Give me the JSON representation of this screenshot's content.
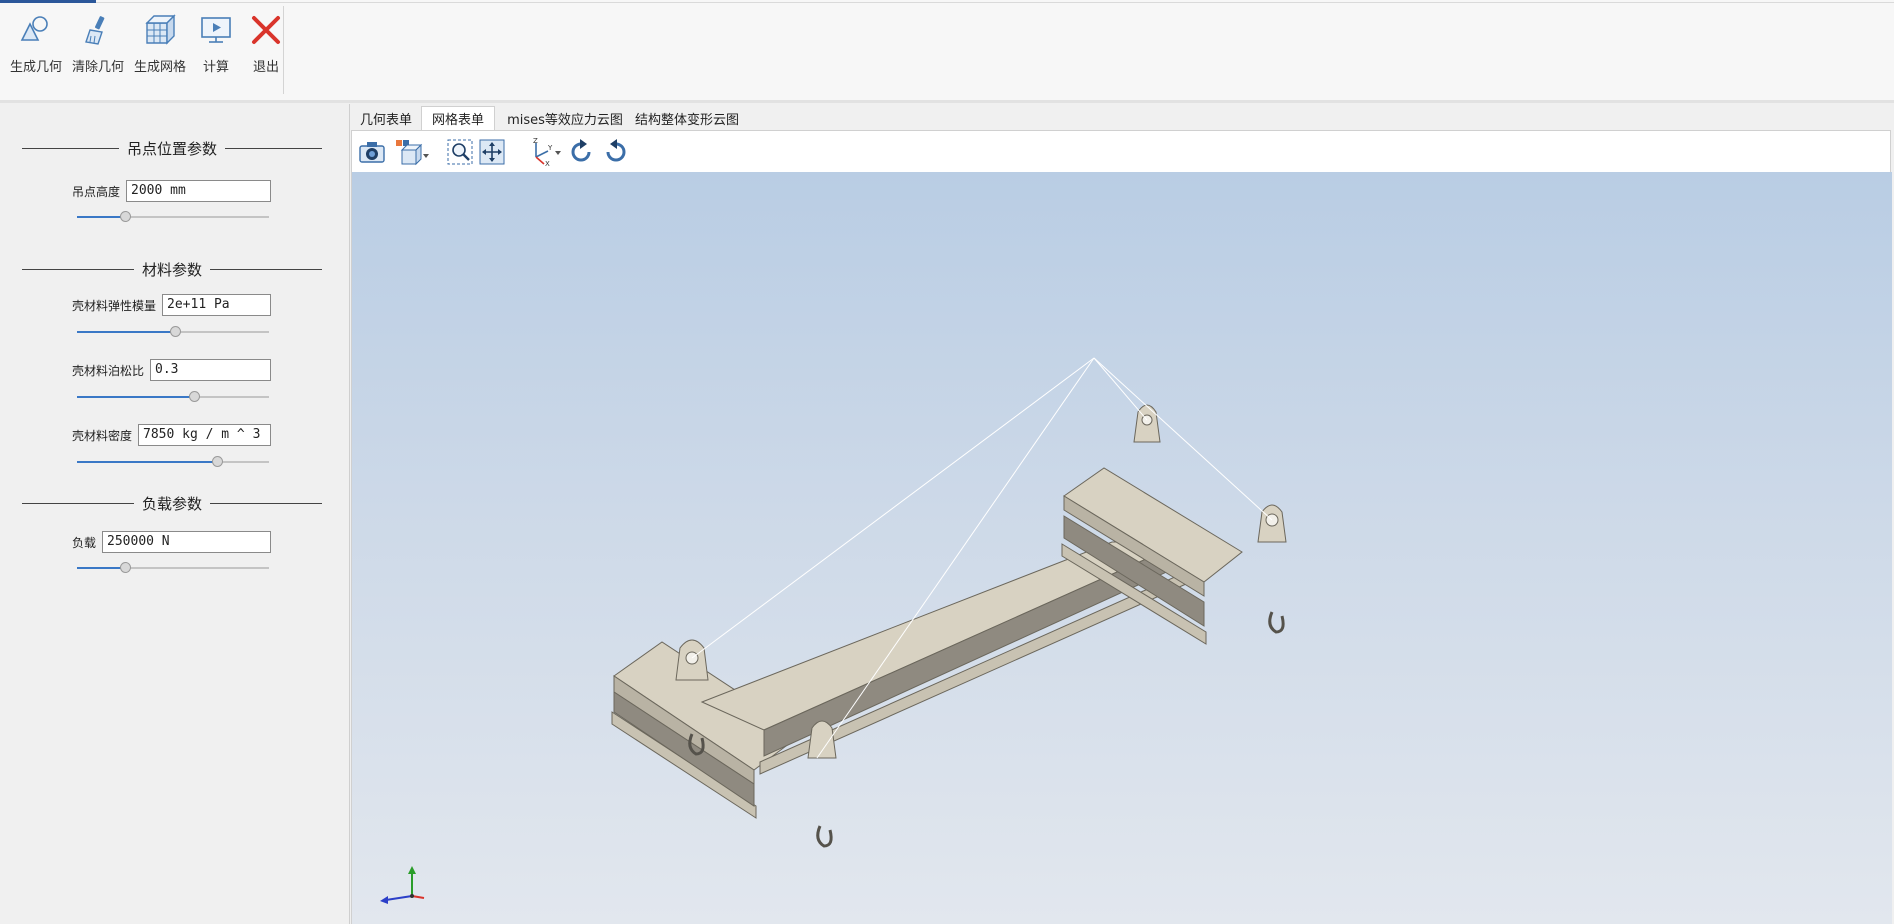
{
  "ribbon": {
    "buttons": [
      {
        "label": "生成几何",
        "icon": "geometry-shapes-icon"
      },
      {
        "label": "清除几何",
        "icon": "brush-icon"
      },
      {
        "label": "生成网格",
        "icon": "mesh-cube-icon"
      },
      {
        "label": "计算",
        "icon": "monitor-play-icon"
      },
      {
        "label": "退出",
        "icon": "close-x-icon"
      }
    ]
  },
  "left_panel": {
    "sections": {
      "hook": {
        "title": "吊点位置参数"
      },
      "material": {
        "title": "材料参数"
      },
      "load": {
        "title": "负载参数"
      }
    },
    "params": {
      "hook_height": {
        "label": "吊点高度",
        "value": "2000 mm",
        "slider": 0.25
      },
      "youngs": {
        "label": "壳材料弹性模量",
        "value": "2e+11 Pa",
        "slider": 0.51
      },
      "poisson": {
        "label": "壳材料泊松比",
        "value": "0.3",
        "slider": 0.61
      },
      "density": {
        "label": "壳材料密度",
        "value": "7850 kg / m ^ 3",
        "slider": 0.73
      },
      "load": {
        "label": "负载",
        "value": "250000 N",
        "slider": 0.25
      }
    }
  },
  "tabs": [
    "几何表单",
    "网格表单",
    "mises等效应力云图",
    "结构整体变形云图"
  ],
  "active_tab": 1,
  "toolbar": [
    "camera-icon",
    "view-cube-dropdown-icon",
    "zoom-box-icon",
    "pan-fit-icon",
    "axes-orientation-icon",
    "rotate-clockwise-icon",
    "rotate-counterclockwise-icon"
  ],
  "colors": {
    "accent": "#2b579a",
    "slider_fill": "#3a78c6",
    "exit_red": "#d9342b",
    "beam": "#d8d2c2"
  }
}
